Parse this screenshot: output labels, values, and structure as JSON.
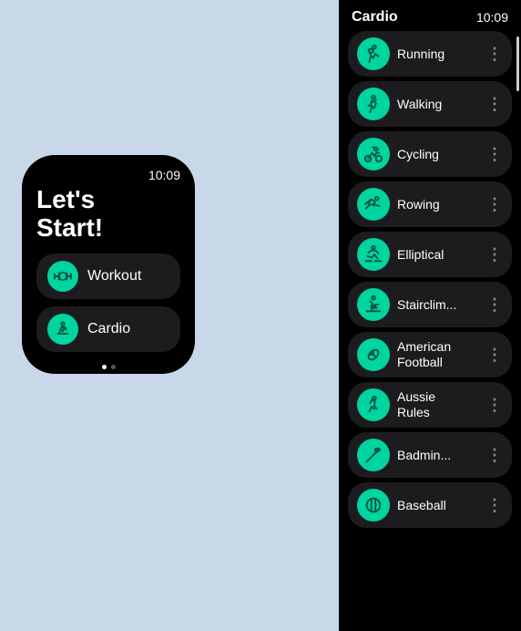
{
  "left_watch": {
    "time": "10:09",
    "greeting": "Let's\nStart!",
    "menu_items": [
      {
        "id": "workout",
        "label": "Workout",
        "icon": "dumbbell"
      },
      {
        "id": "cardio",
        "label": "Cardio",
        "icon": "running"
      }
    ],
    "dots": [
      "active",
      "inactive"
    ]
  },
  "right_watch": {
    "title": "Cardio",
    "time": "10:09",
    "items": [
      {
        "id": "running",
        "label": "Running",
        "icon": "🏃"
      },
      {
        "id": "walking",
        "label": "Walking",
        "icon": "🚶"
      },
      {
        "id": "cycling",
        "label": "Cycling",
        "icon": "🚴"
      },
      {
        "id": "rowing",
        "label": "Rowing",
        "icon": "🚣"
      },
      {
        "id": "elliptical",
        "label": "Elliptical",
        "icon": "🏃"
      },
      {
        "id": "stairclimber",
        "label": "Stairclim...",
        "icon": "🧗"
      },
      {
        "id": "american-football",
        "label": "American\nFootball",
        "icon": "🏈"
      },
      {
        "id": "aussie-rules",
        "label": "Aussie\nRules",
        "icon": "🏉"
      },
      {
        "id": "badminton",
        "label": "Badmin...",
        "icon": "🏸"
      },
      {
        "id": "baseball",
        "label": "Baseball",
        "icon": "⚾"
      }
    ],
    "more_icon": "⋮"
  },
  "icons": {
    "dumbbell": "💪",
    "running": "🏃",
    "more": "⋮"
  }
}
